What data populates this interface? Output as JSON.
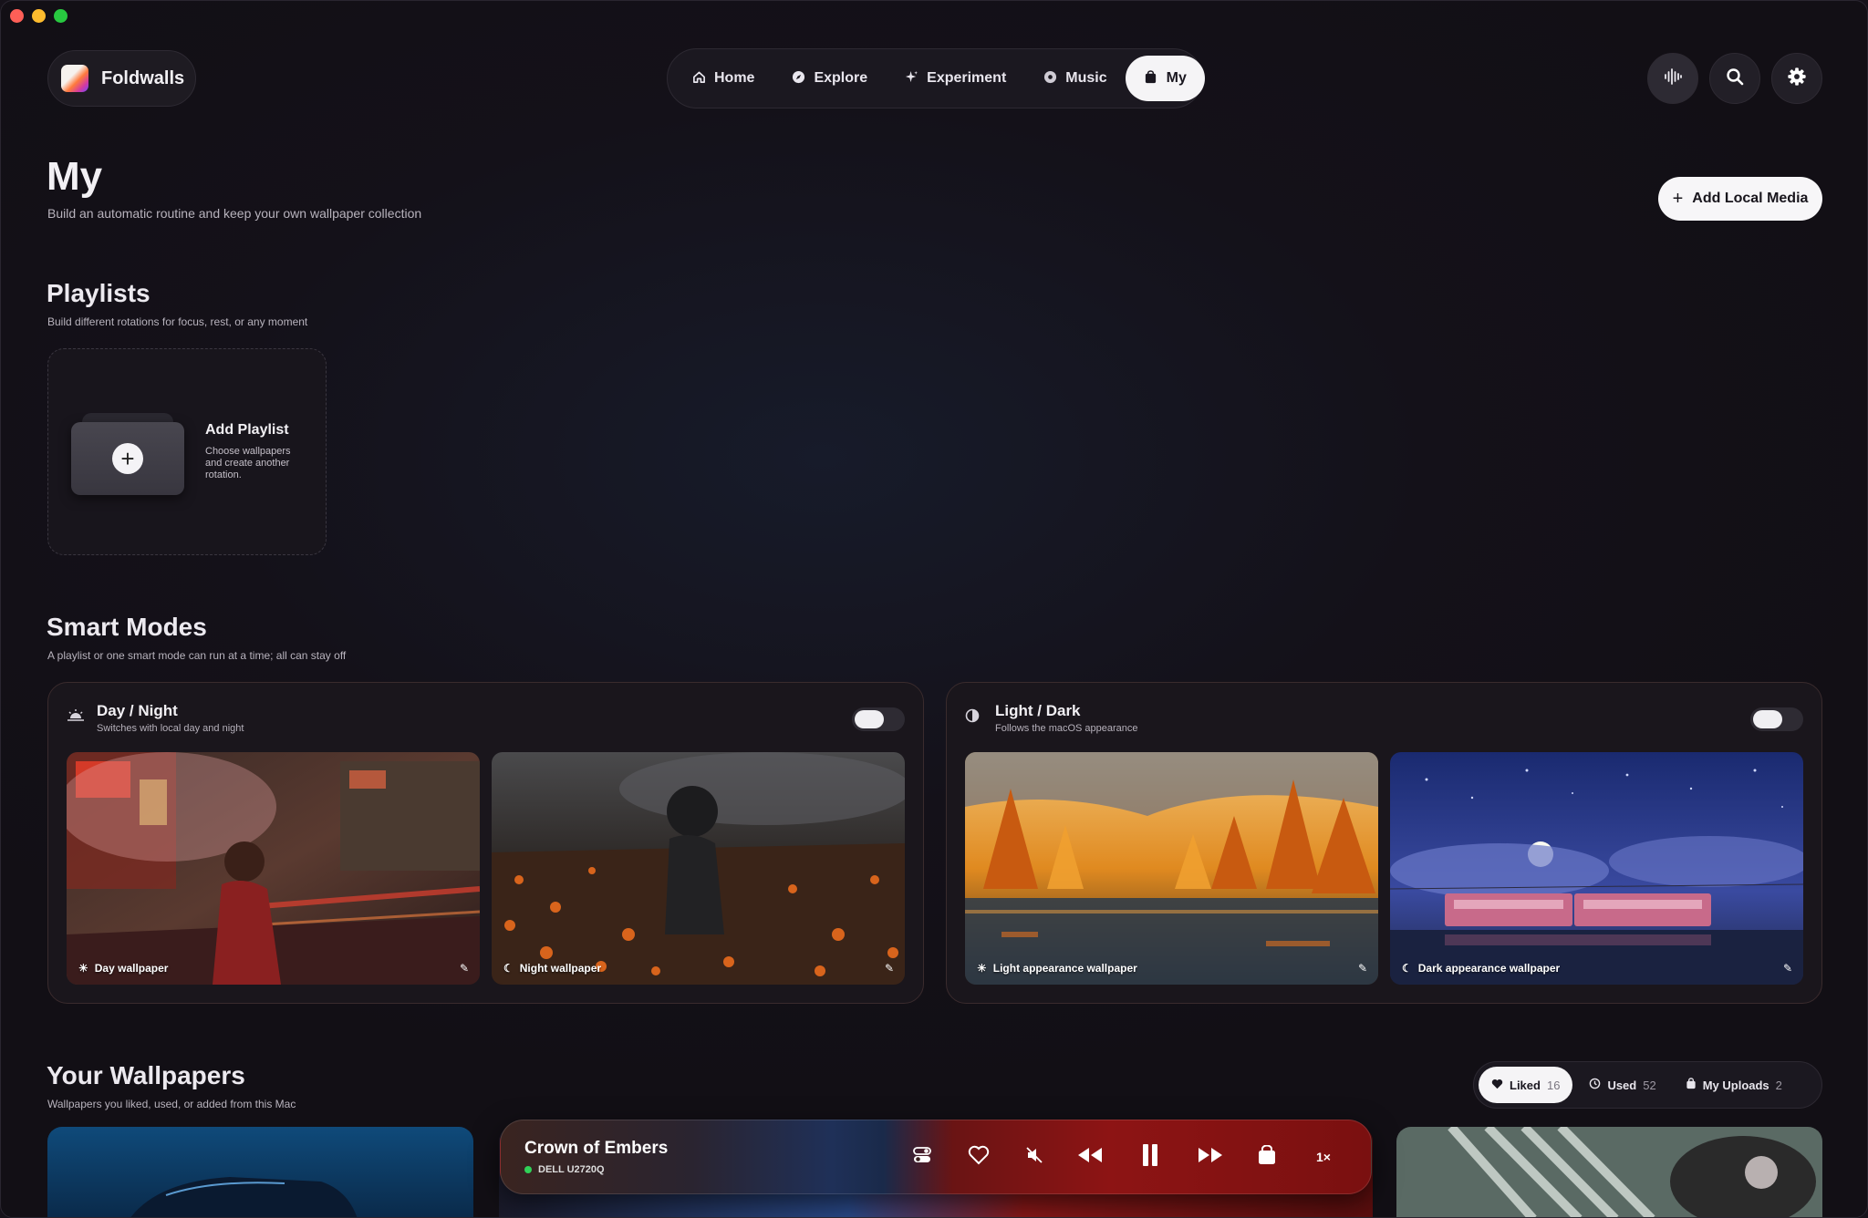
{
  "app": {
    "name": "Foldwalls"
  },
  "nav": [
    {
      "label": "Home",
      "icon": "home-icon"
    },
    {
      "label": "Explore",
      "icon": "compass-icon"
    },
    {
      "label": "Experiment",
      "icon": "sparkle-icon"
    },
    {
      "label": "Music",
      "icon": "music-icon"
    },
    {
      "label": "My",
      "icon": "bag-icon",
      "active": true
    }
  ],
  "header_buttons": [
    "waveform-icon",
    "search-icon",
    "gear-icon"
  ],
  "page": {
    "title": "My",
    "subtitle": "Build an automatic routine and keep your own wallpaper collection",
    "add_media_label": "Add Local Media"
  },
  "playlists": {
    "title": "Playlists",
    "subtitle": "Build different rotations for focus, rest, or any moment",
    "add": {
      "title": "Add Playlist",
      "description": "Choose wallpapers and create another rotation."
    }
  },
  "smart_modes": {
    "title": "Smart Modes",
    "subtitle": "A playlist or one smart mode can run at a time; all can stay off",
    "modes": [
      {
        "title": "Day / Night",
        "subtitle": "Switches with local day and night",
        "enabled": false,
        "wallpapers": [
          {
            "label": "Day wallpaper",
            "icon": "sun-icon"
          },
          {
            "label": "Night wallpaper",
            "icon": "moon-icon"
          }
        ]
      },
      {
        "title": "Light / Dark",
        "subtitle": "Follows the macOS appearance",
        "enabled": false,
        "wallpapers": [
          {
            "label": "Light appearance wallpaper",
            "icon": "sun-icon"
          },
          {
            "label": "Dark appearance wallpaper",
            "icon": "moon-icon"
          }
        ]
      }
    ]
  },
  "your_wallpapers": {
    "title": "Your Wallpapers",
    "subtitle": "Wallpapers you liked, used, or added from this Mac",
    "tabs": [
      {
        "label": "Liked",
        "count": "16",
        "active": true
      },
      {
        "label": "Used",
        "count": "52"
      },
      {
        "label": "My Uploads",
        "count": "2"
      }
    ]
  },
  "player": {
    "title": "Crown of Embers",
    "display": "DELL U2720Q",
    "speed": "1×",
    "status_color": "#30d158"
  },
  "colors": {
    "accent_light": "#f5f4f6",
    "background": "#141119"
  }
}
